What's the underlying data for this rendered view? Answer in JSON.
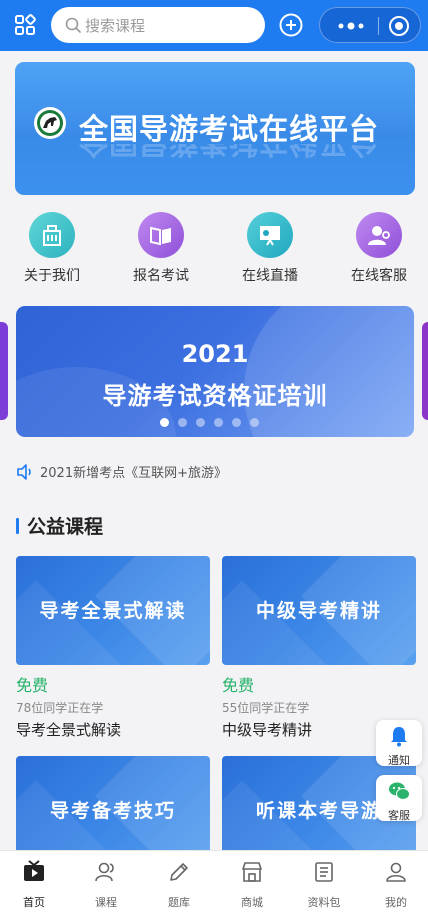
{
  "search": {
    "placeholder": "搜索课程"
  },
  "banner": {
    "title": "全国导游考试在线平台"
  },
  "quick_entries": [
    {
      "label": "关于我们",
      "icon": "building-icon",
      "color": "#3bc2c5"
    },
    {
      "label": "报名考试",
      "icon": "book-icon",
      "color": "#a35de0"
    },
    {
      "label": "在线直播",
      "icon": "live-board-icon",
      "color": "#2fb8c9"
    },
    {
      "label": "在线客服",
      "icon": "customer-service-icon",
      "color": "#a35de0"
    }
  ],
  "carousel": {
    "line1": "2021",
    "line2": "导游考试资格证培训",
    "slide_count": 6,
    "active_index": 0
  },
  "notice": {
    "text": "2021新增考点《互联网+旅游》"
  },
  "section": {
    "title": "公益课程"
  },
  "courses": [
    {
      "thumb_text": "导考全景式解读",
      "price": "免费",
      "learners": "78位同学正在学",
      "name": "导考全景式解读"
    },
    {
      "thumb_text": "中级导考精讲",
      "price": "免费",
      "learners": "55位同学正在学",
      "name": "中级导考精讲"
    },
    {
      "thumb_text": "导考备考技巧"
    },
    {
      "thumb_text": "听课本考导游"
    }
  ],
  "float_buttons": [
    {
      "label": "通知",
      "icon": "bell-icon"
    },
    {
      "label": "客服",
      "icon": "wechat-icon"
    }
  ],
  "tabs": [
    {
      "label": "首页",
      "icon": "video-home-icon",
      "active": true
    },
    {
      "label": "课程",
      "icon": "users-icon"
    },
    {
      "label": "题库",
      "icon": "pencil-icon"
    },
    {
      "label": "商城",
      "icon": "shop-icon"
    },
    {
      "label": "资料包",
      "icon": "document-icon"
    },
    {
      "label": "我的",
      "icon": "user-icon"
    }
  ],
  "colors": {
    "brand_blue": "#1f7bf0",
    "free_green": "#27b36a"
  }
}
